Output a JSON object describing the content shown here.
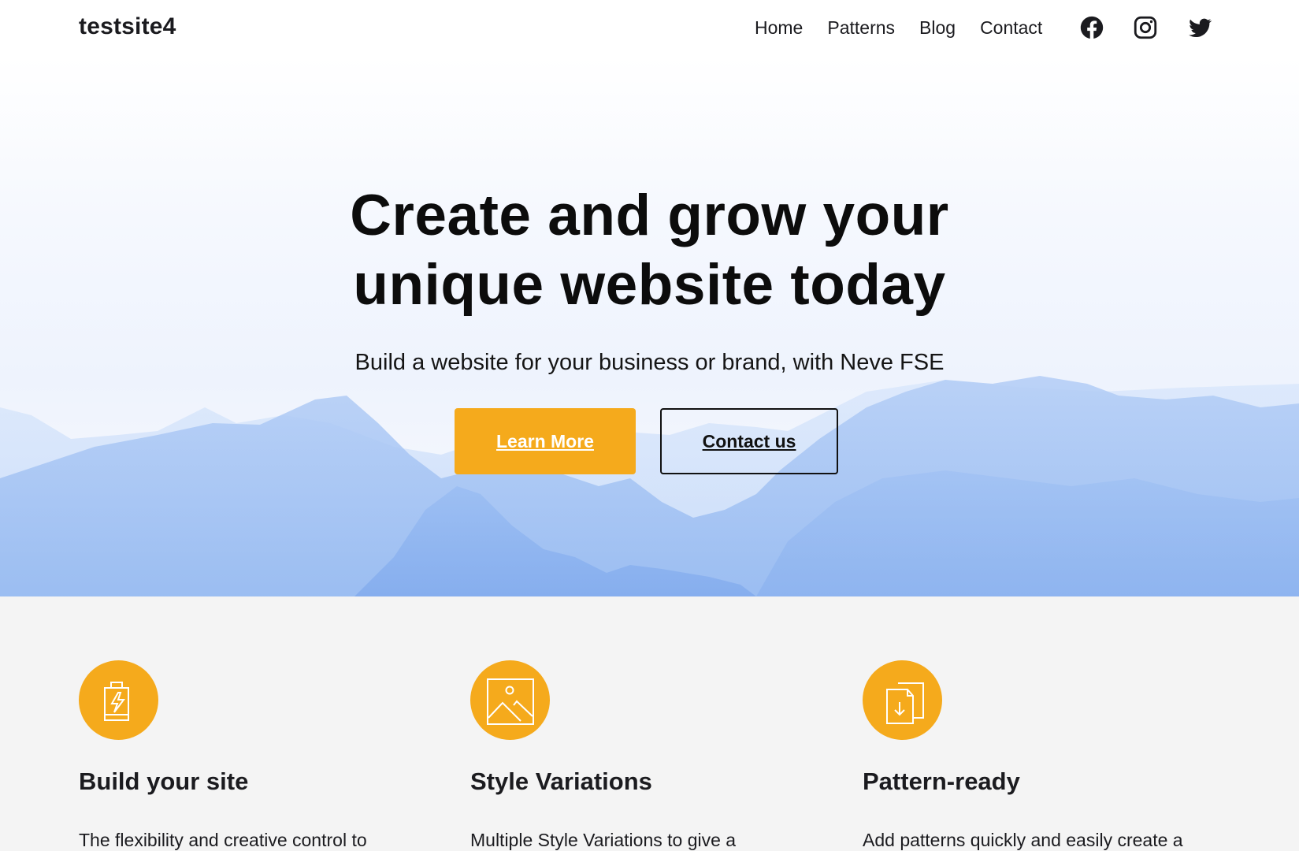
{
  "site": {
    "title": "testsite4"
  },
  "nav": {
    "items": [
      {
        "label": "Home"
      },
      {
        "label": "Patterns"
      },
      {
        "label": "Blog"
      },
      {
        "label": "Contact"
      }
    ],
    "social": [
      {
        "name": "facebook",
        "icon": "facebook-icon"
      },
      {
        "name": "instagram",
        "icon": "instagram-icon"
      },
      {
        "name": "twitter",
        "icon": "twitter-icon"
      }
    ]
  },
  "hero": {
    "title_line1": "Create and grow your",
    "title_line2": "unique website today",
    "subtitle": "Build a website for your business or brand, with Neve FSE",
    "primary_button": "Learn More",
    "secondary_button": "Contact us"
  },
  "features": [
    {
      "icon": "battery-charging-icon",
      "title": "Build your site",
      "text": "The flexibility and creative control to"
    },
    {
      "icon": "image-icon",
      "title": "Style Variations",
      "text": "Multiple Style Variations to give a"
    },
    {
      "icon": "document-download-icon",
      "title": "Pattern-ready",
      "text": "Add patterns quickly and easily create a"
    }
  ],
  "colors": {
    "accent": "#f5aa1c",
    "text": "#1b1b1f",
    "section_bg": "#f4f4f4",
    "mountain": "#8fb6f2"
  }
}
